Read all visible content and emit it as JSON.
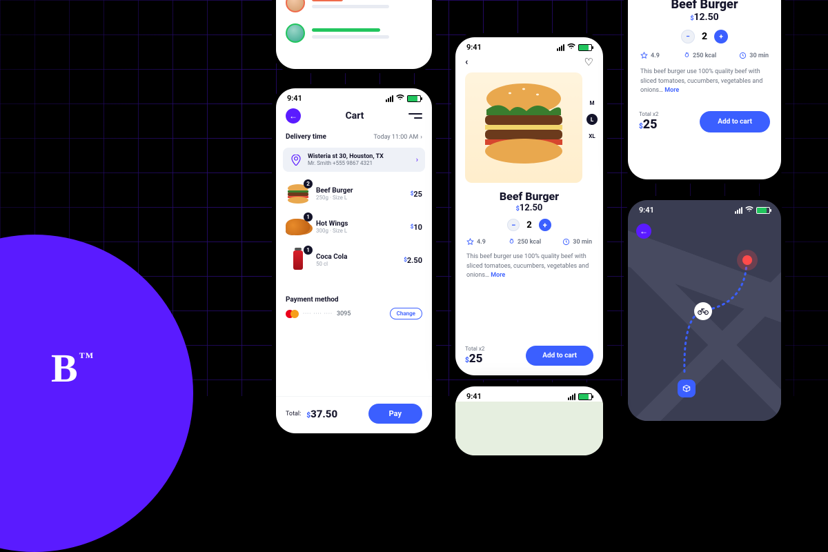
{
  "statusbar": {
    "time": "9:41"
  },
  "logo": {
    "mark": "B",
    "tm": "TM"
  },
  "cart": {
    "title": "Cart",
    "delivery_label": "Delivery time",
    "delivery_value": "Today 11:00 AM",
    "address": {
      "line1": "Wisteria st 30, Houston, TX",
      "line2": "Mr. Smith +555 9867 4321"
    },
    "items": [
      {
        "name": "Beef Burger",
        "sub": "250g · Size L",
        "qty": "2",
        "price": "25"
      },
      {
        "name": "Hot Wings",
        "sub": "300g · Size L",
        "qty": "1",
        "price": "10"
      },
      {
        "name": "Coca Cola",
        "sub": "50 cl",
        "qty": "1",
        "price": "2.50"
      }
    ],
    "payment_label": "Payment method",
    "card_mask": "···· ···· ····",
    "card_last4": "3095",
    "change_label": "Change",
    "total_label": "Total:",
    "total_value": "37.50",
    "pay_label": "Pay",
    "currency": "$"
  },
  "product": {
    "name": "Beef Burger",
    "price": "12.50",
    "currency": "$",
    "qty": "2",
    "sizes": {
      "m": "M",
      "l": "L",
      "xl": "XL"
    },
    "stats": {
      "rating": "4.9",
      "cal": "250 kcal",
      "time": "30 min"
    },
    "desc": "This beef burger use 100% quality beef with sliced tomatoes, cucumbers, vegetables and onions…",
    "more": "More",
    "total_label": "Total x2",
    "total_value": "25",
    "add_label": "Add to cart"
  }
}
